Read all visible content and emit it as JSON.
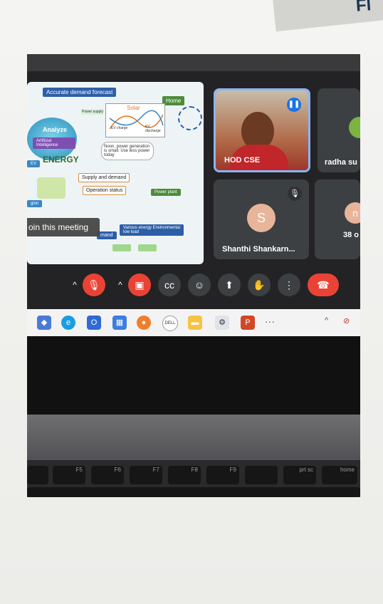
{
  "brand_corner": "Fl",
  "slide": {
    "title_box": "Accurate demand forecast",
    "home": "Home",
    "analyze": "Analyze",
    "ai": "Artificial Intelligence",
    "energy": "ENERGY",
    "ev": "EV",
    "solar": "Solar",
    "ev_discharge": "EV discharge",
    "ev_charge": "EV charge",
    "power_supply": "Power supply",
    "noon_bubble": "Noon, power generation is small. Use less power today",
    "supply_demand": "Supply and demand",
    "operation_status": "Operation status",
    "power_plant": "Power plant",
    "various_energy": "Various energy Environmental low load",
    "demand": "mand",
    "gion": "gion"
  },
  "join_tooltip": "oin this meeting",
  "tiles": {
    "hod": {
      "name": "HOD CSE"
    },
    "radha": {
      "name": "radha su"
    },
    "shanthi": {
      "name": "Shanthi Shankarn...",
      "initial": "S"
    },
    "others": {
      "name": "38 o",
      "initial": "n"
    }
  },
  "controls": {
    "mic_caret": "^",
    "mic": "mic-off-icon",
    "cam_caret": "^",
    "cam": "camera-off-icon",
    "captions": "captions-icon",
    "emoji": "emoji-icon",
    "present": "present-icon",
    "hand": "raise-hand-icon",
    "more": "more-icon",
    "leave": "end-call-icon"
  },
  "taskbar": {
    "more": "···",
    "dell": "DELL"
  },
  "keyboard": {
    "f5": "F5",
    "f6": "F6",
    "f7": "F7",
    "f8": "F8",
    "f9": "F9",
    "prt_sc": "prt sc",
    "home": "home"
  },
  "colors": {
    "meet_bg": "#232325",
    "tile_bg": "#3c4043",
    "end_call": "#ea4335",
    "active_speaker": "#8ab4f8",
    "avatar": "#e8b59a"
  }
}
